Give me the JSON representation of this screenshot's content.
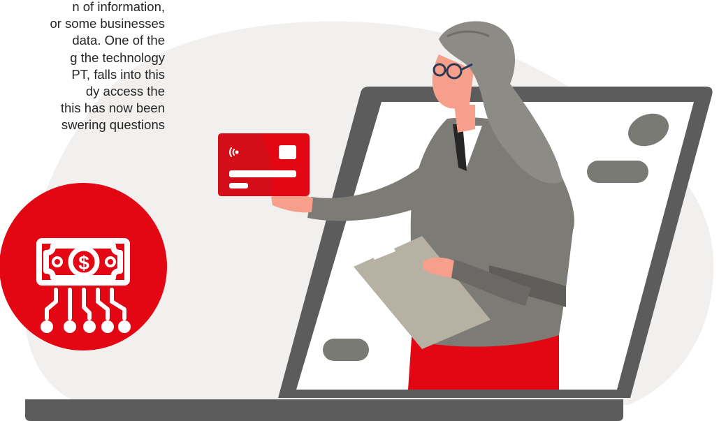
{
  "article": {
    "lines": [
      "n of information,",
      "or some businesses",
      "data. One of the",
      "g the technology",
      "PT, falls into this",
      "dy access the",
      "this has now been",
      "swering questions"
    ]
  },
  "colors": {
    "brand_red": "#e30613",
    "background_blob": "#f1f0ee",
    "laptop_frame": "#5b5c5b",
    "screen": "#ffffff",
    "cardigan": "#7d7b76",
    "hair": "#8c8b86",
    "skin": "#f6a08c",
    "clipboard": "#b6b1a3",
    "skirt": "#e30613"
  },
  "icons": {
    "badge": "money-circuit-icon",
    "card_contactless": "contactless-icon",
    "card_chip": "chip-icon"
  }
}
